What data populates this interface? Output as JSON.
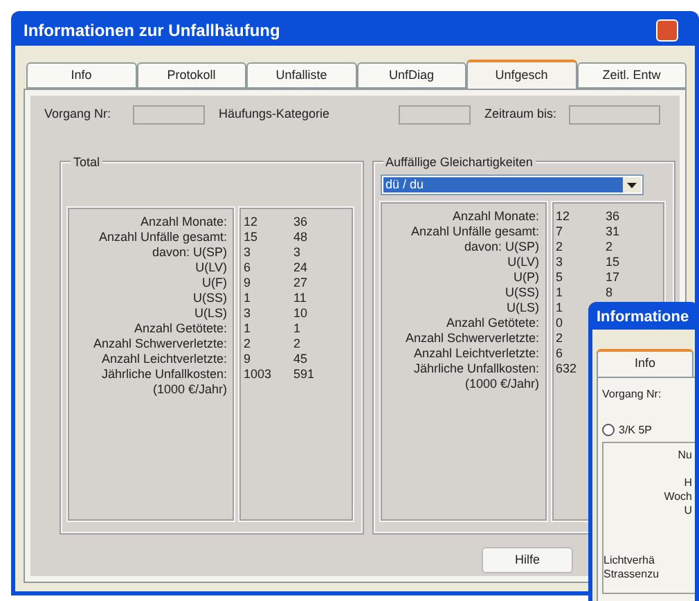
{
  "window": {
    "title": "Informationen zur Unfallhäufung"
  },
  "tabs": [
    {
      "label": "Info",
      "selected": false
    },
    {
      "label": "Protokoll",
      "selected": false
    },
    {
      "label": "Unfalliste",
      "selected": false
    },
    {
      "label": "UnfDiag",
      "selected": false
    },
    {
      "label": "Unfgesch",
      "selected": true
    },
    {
      "label": "Zeitl. Entw",
      "selected": false
    }
  ],
  "header_fields": [
    {
      "label": "Vorgang Nr:"
    },
    {
      "label": "Häufungs-Kategorie"
    },
    {
      "label": "Zeitraum bis:"
    }
  ],
  "total": {
    "title": "Total",
    "rows": [
      {
        "label": "Anzahl Monate:",
        "values": [
          "12",
          "36"
        ]
      },
      {
        "label": "Anzahl Unfälle gesamt:",
        "values": [
          "15",
          "48"
        ]
      },
      {
        "label": "davon: U(SP)",
        "values": [
          "3",
          "3"
        ]
      },
      {
        "label": "U(LV)",
        "values": [
          "6",
          "24"
        ]
      },
      {
        "label": "U(F)",
        "values": [
          "9",
          "27"
        ]
      },
      {
        "label": "U(SS)",
        "values": [
          "1",
          "11"
        ]
      },
      {
        "label": "U(LS)",
        "values": [
          "3",
          "10"
        ]
      },
      {
        "label": "Anzahl Getötete:",
        "values": [
          "1",
          "1"
        ]
      },
      {
        "label": "Anzahl Schwerverletzte:",
        "values": [
          "2",
          "2"
        ]
      },
      {
        "label": "Anzahl Leichtverletzte:",
        "values": [
          "9",
          "45"
        ]
      },
      {
        "label": "Jährliche Unfallkosten:",
        "values": [
          "1003",
          "591"
        ]
      },
      {
        "label": "(1000 €/Jahr)",
        "values": []
      }
    ]
  },
  "similarities": {
    "title": "Auffällige Gleichartigkeiten",
    "dropdown": {
      "value": "dü / du"
    },
    "rows": [
      {
        "label": "Anzahl Monate:",
        "values": [
          "12",
          "36"
        ]
      },
      {
        "label": "Anzahl Unfälle gesamt:",
        "values": [
          "7",
          "31"
        ]
      },
      {
        "label": "davon: U(SP)",
        "values": [
          "2",
          "2"
        ]
      },
      {
        "label": "U(LV)",
        "values": [
          "3",
          "15"
        ]
      },
      {
        "label": "U(P)",
        "values": [
          "5",
          "17"
        ]
      },
      {
        "label": "U(SS)",
        "values": [
          "1",
          "8"
        ]
      },
      {
        "label": "U(LS)",
        "values": [
          "1"
        ]
      },
      {
        "label": "Anzahl Getötete:",
        "values": [
          "0"
        ]
      },
      {
        "label": "Anzahl Schwerverletzte:",
        "values": [
          "2"
        ]
      },
      {
        "label": "Anzahl Leichtverletzte:",
        "values": [
          "6"
        ]
      },
      {
        "label": "Jährliche Unfallkosten:",
        "values": [
          "632"
        ]
      },
      {
        "label": "(1000 €/Jahr)",
        "values": []
      }
    ]
  },
  "buttons": [
    "Hilfe"
  ],
  "second_window": {
    "title": "Informatione",
    "tabs": [
      {
        "label": "Info",
        "selected": true
      }
    ],
    "field_label": "Vorgang Nr:",
    "radio": {
      "label": "3/K 5P",
      "selected": false
    },
    "field_labels": [
      "Nu",
      "H",
      "Woch",
      "U"
    ],
    "bottom_labels": [
      "Lichtverhä",
      "Strassenzu"
    ]
  }
}
